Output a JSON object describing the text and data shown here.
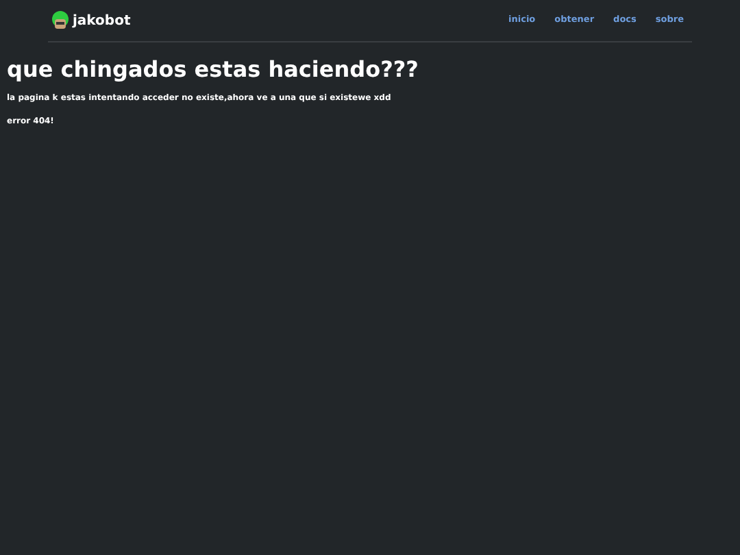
{
  "header": {
    "brand": "jakobot",
    "nav": [
      {
        "label": "inicio"
      },
      {
        "label": "obtener"
      },
      {
        "label": "docs"
      },
      {
        "label": "sobre"
      }
    ]
  },
  "title": "que chingados estas haciendo???",
  "message": "la pagina k estas intentando acceder no existe,ahora ve a una que si existewe xdd",
  "error": "error 404!"
}
